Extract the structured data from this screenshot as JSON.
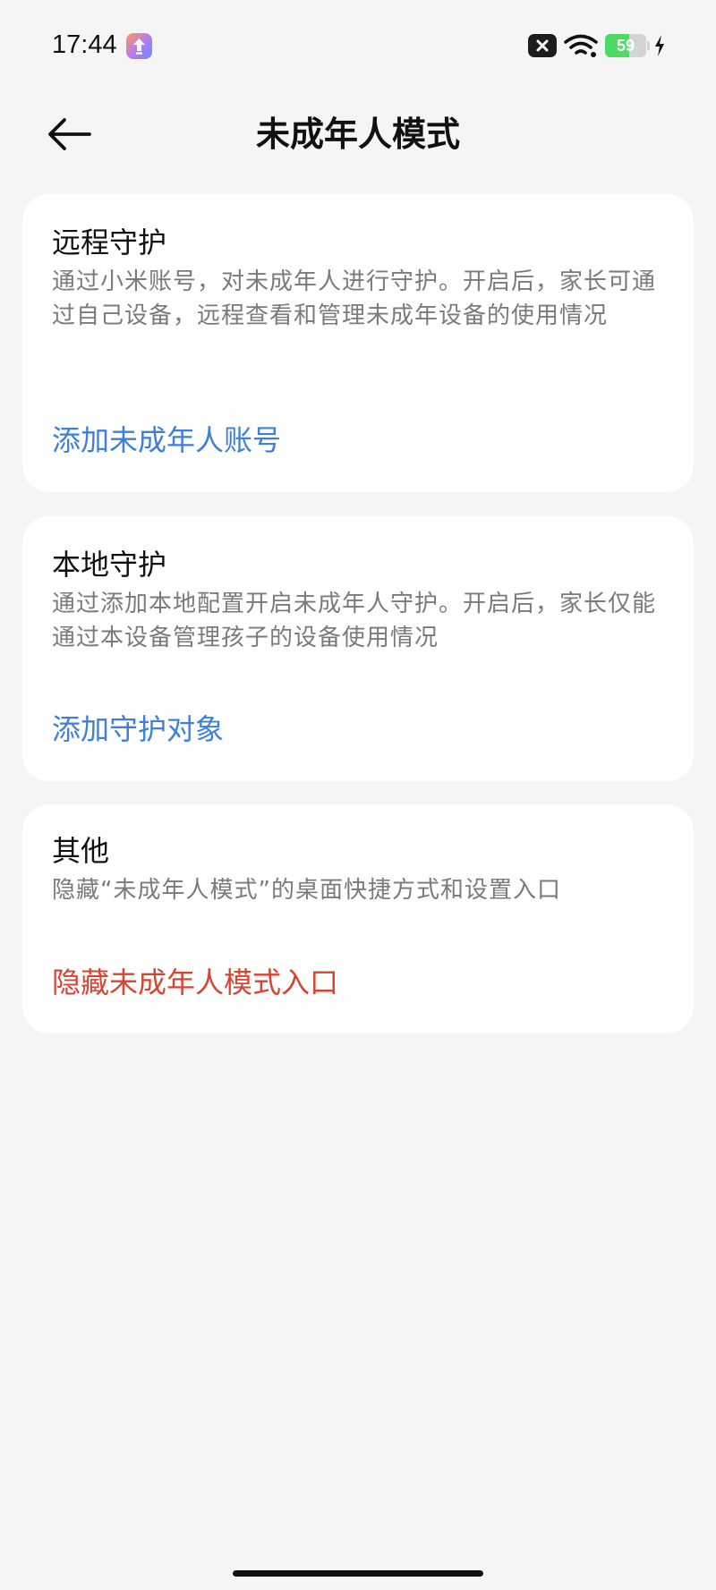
{
  "status_bar": {
    "time": "17:44",
    "battery_level": "59",
    "battery_percent": 59,
    "battery_color": "#4cd964",
    "icons": [
      "app-update-icon",
      "sim-disabled-icon",
      "wifi-icon",
      "battery-icon",
      "charging-bolt-icon"
    ]
  },
  "header": {
    "back_icon": "arrow-left-icon",
    "title": "未成年人模式"
  },
  "sections": {
    "remote": {
      "title": "远程守护",
      "description": "通过小米账号，对未成年人进行守护。开启后，家长可通过自己设备，远程查看和管理未成年设备的使用情况",
      "action": "添加未成年人账号"
    },
    "local": {
      "title": "本地守护",
      "description": "通过添加本地配置开启未成年人守护。开启后，家长仅能通过本设备管理孩子的设备使用情况",
      "action": "添加守护对象"
    },
    "other": {
      "title": "其他",
      "description": "隐藏“未成年人模式”的桌面快捷方式和设置入口",
      "action": "隐藏未成年人模式入口"
    }
  },
  "colors": {
    "background": "#f5f5f5",
    "card": "#ffffff",
    "link_blue": "#3e7fd8",
    "danger_red": "#d64532",
    "secondary_text": "#7a7a7a"
  }
}
